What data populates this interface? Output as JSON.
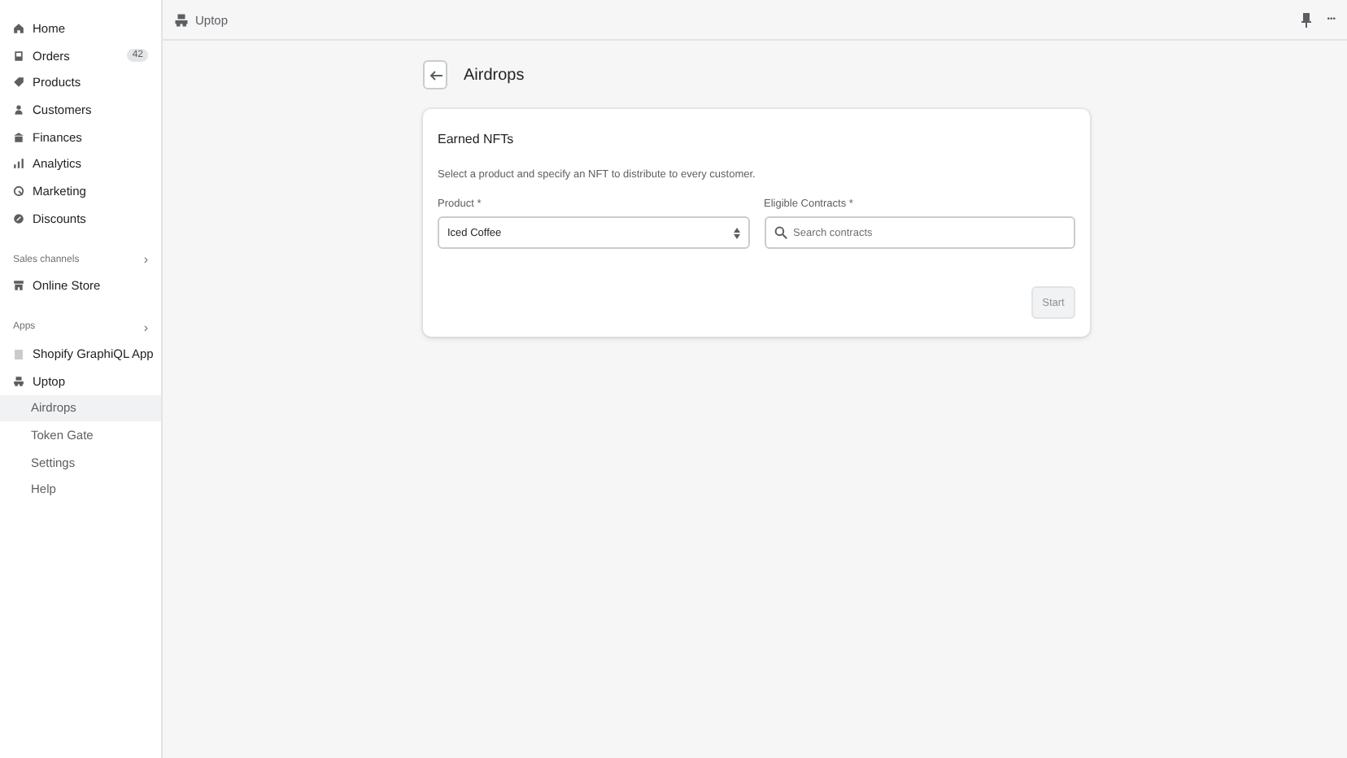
{
  "sidebar": {
    "items": [
      {
        "label": "Home",
        "selected": false
      },
      {
        "label": "Orders",
        "badge": "42",
        "selected": false
      },
      {
        "label": "Products",
        "selected": false
      },
      {
        "label": "Customers",
        "selected": false
      },
      {
        "label": "Finances",
        "selected": false
      },
      {
        "label": "Analytics",
        "selected": false
      },
      {
        "label": "Marketing",
        "selected": false
      },
      {
        "label": "Discounts",
        "selected": false
      }
    ],
    "sales_channels": {
      "heading": "Sales channels",
      "chevron": "›",
      "items": [
        {
          "label": "Online Store",
          "selected": false
        }
      ]
    },
    "apps": {
      "heading": "Apps",
      "chevron": "›",
      "items": [
        {
          "label": "Shopify GraphiQL App",
          "selected": false
        },
        {
          "label": "Uptop",
          "selected": false,
          "children": [
            {
              "label": "Airdrops",
              "selected": true
            },
            {
              "label": "Token Gate",
              "selected": false
            },
            {
              "label": "Settings",
              "selected": false
            },
            {
              "label": "Help",
              "selected": false
            }
          ]
        }
      ]
    }
  },
  "top_bar": {
    "app_name": "Uptop",
    "more": "•••"
  },
  "page": {
    "title": "Airdrops",
    "card": {
      "title": "Earned NFTs",
      "description": "Select a product and specify an NFT to distribute to every customer.",
      "product": {
        "label": "Product *",
        "value": "Iced Coffee"
      },
      "contracts": {
        "label": "Eligible Contracts *",
        "placeholder": "Search contracts"
      },
      "start_button": {
        "label": "Start",
        "disabled": true
      }
    }
  }
}
